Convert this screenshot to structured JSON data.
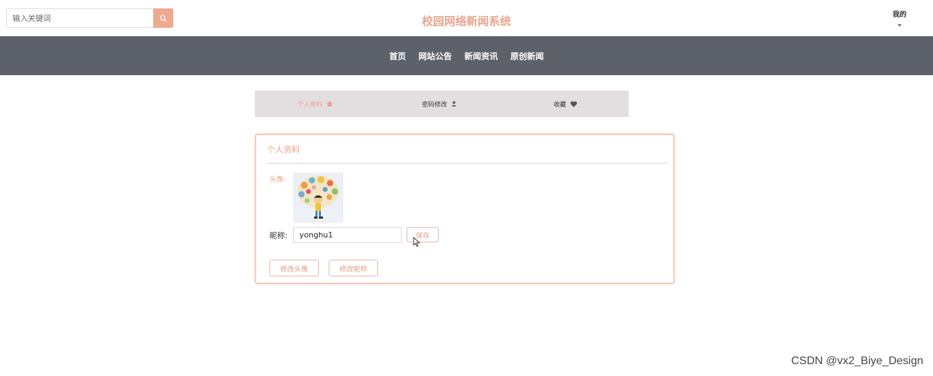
{
  "header": {
    "search_placeholder": "输入关键词",
    "site_title": "校园网络新闻系统",
    "account_label": "我的"
  },
  "nav": {
    "items": [
      "首页",
      "网站公告",
      "新闻资讯",
      "原创新闻"
    ]
  },
  "tabs": {
    "profile": "个人资料",
    "password": "密码修改",
    "favorites": "收藏"
  },
  "profile": {
    "card_title": "个人资料",
    "avatar_label": "头像:",
    "nickname_label": "昵称:",
    "nickname_value": "yonghu1",
    "save_button": "保存",
    "change_avatar_button": "修改头像",
    "change_nickname_button": "修改昵称"
  },
  "watermark": "CSDN @vx2_Biye_Design",
  "colors": {
    "accent": "#e9a58e",
    "nav_bg": "#5d6169",
    "search_button": "#eeaa90",
    "tab_bar_bg": "#e3dfe0"
  }
}
